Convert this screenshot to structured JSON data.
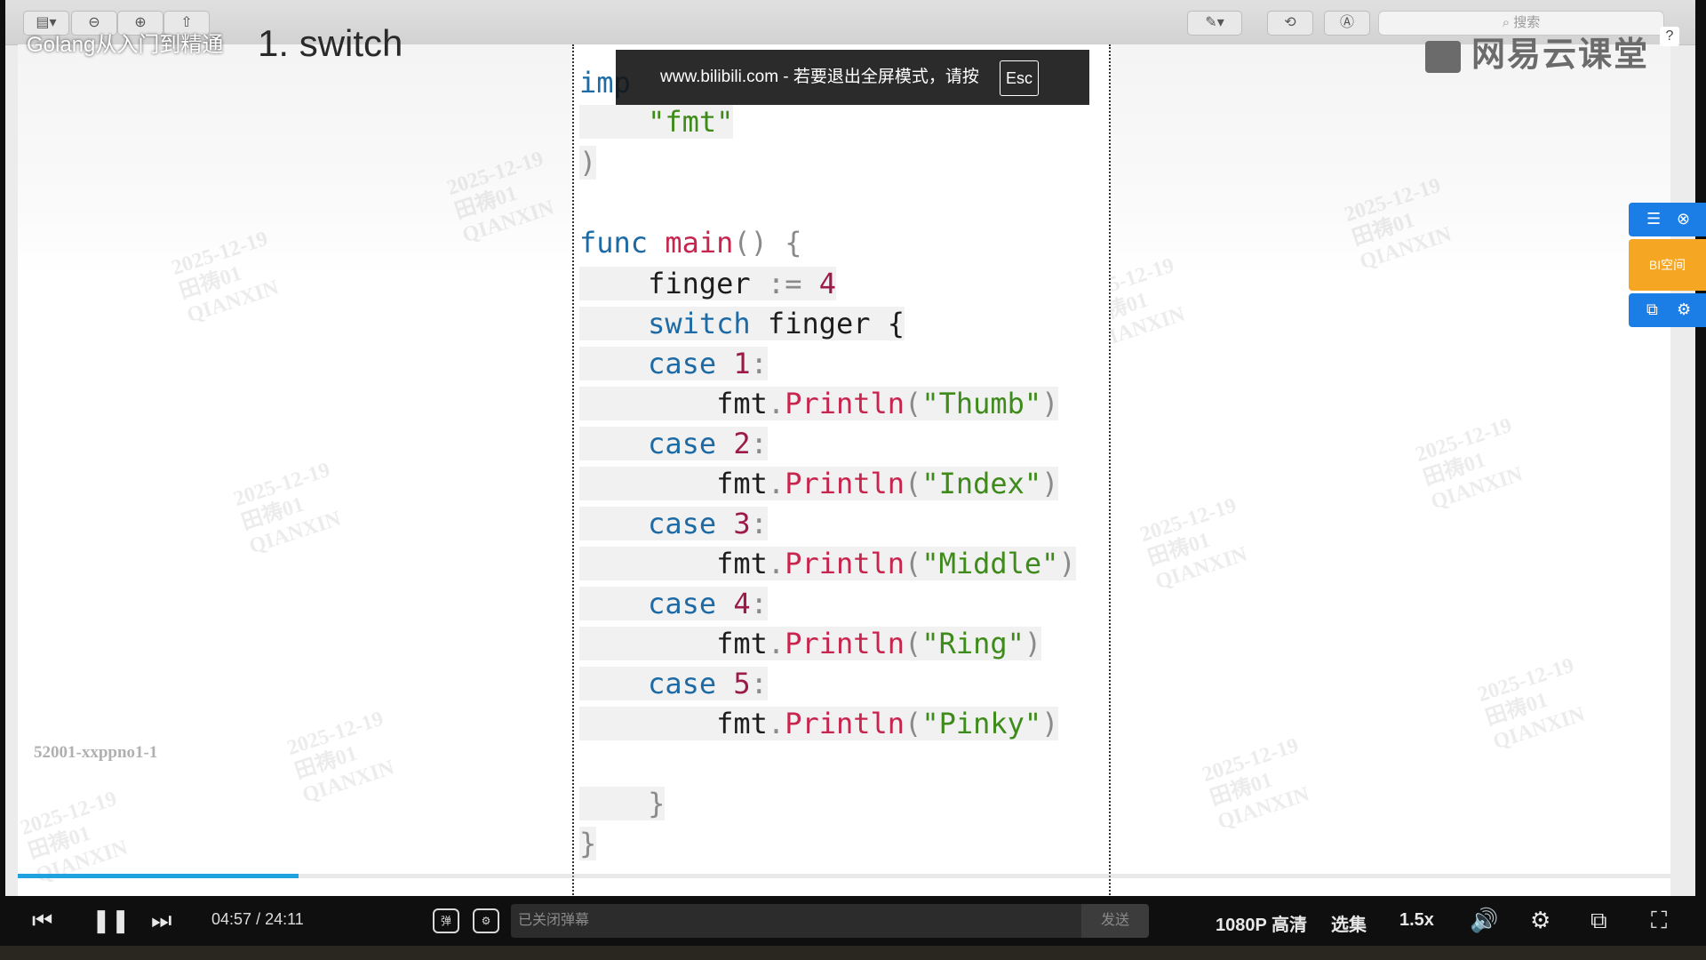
{
  "toolbar": {
    "search_placeholder": "搜索",
    "icons": [
      "sidebar-icon",
      "zoom-out-icon",
      "zoom-in-icon",
      "share-icon",
      "pen-icon",
      "rotate-icon",
      "markup-icon"
    ]
  },
  "video": {
    "course_title": "Golang从入门到精通",
    "brand": "网易云课堂",
    "help": "?",
    "doc_id": "52001-xxppno1-1",
    "slide_title": "1. switch"
  },
  "fullscreen_notice": {
    "text": "www.bilibili.com - 若要退出全屏模式，请按",
    "key": "Esc"
  },
  "code": {
    "import_frag": "imp",
    "fmt_pkg": "\"fmt\"",
    "close_paren": ")",
    "func_kw": "func",
    "main_name": "main",
    "main_rest": "() {",
    "finger_var": "finger",
    "assign_op": " := ",
    "finger_val": "4",
    "switch_kw": "switch",
    "switch_rest": " finger {",
    "case_kw": "case",
    "fmt_obj": "fmt",
    "println": "Println",
    "cases": [
      {
        "num": "1",
        "str": "\"Thumb\""
      },
      {
        "num": "2",
        "str": "\"Index\""
      },
      {
        "num": "3",
        "str": "\"Middle\""
      },
      {
        "num": "4",
        "str": "\"Ring\""
      },
      {
        "num": "5",
        "str": "\"Pinky\""
      }
    ],
    "close_brace": "}"
  },
  "watermark": {
    "date": "2025-12-19",
    "user": "田祷01",
    "org": "QIANXIN"
  },
  "side_panel": {
    "bi_label": "BI空间"
  },
  "player": {
    "current_time": "04:57",
    "separator": "/",
    "total_time": "24:11",
    "progress": 0.17,
    "danmaku_placeholder": "已关闭弹幕",
    "send_label": "发送",
    "quality": "1080P 高清",
    "episodes": "选集",
    "speed": "1.5x"
  },
  "colors": {
    "progress": "#1fa3e0",
    "side_blue": "#1a7ee6",
    "side_orange": "#f5a623"
  }
}
